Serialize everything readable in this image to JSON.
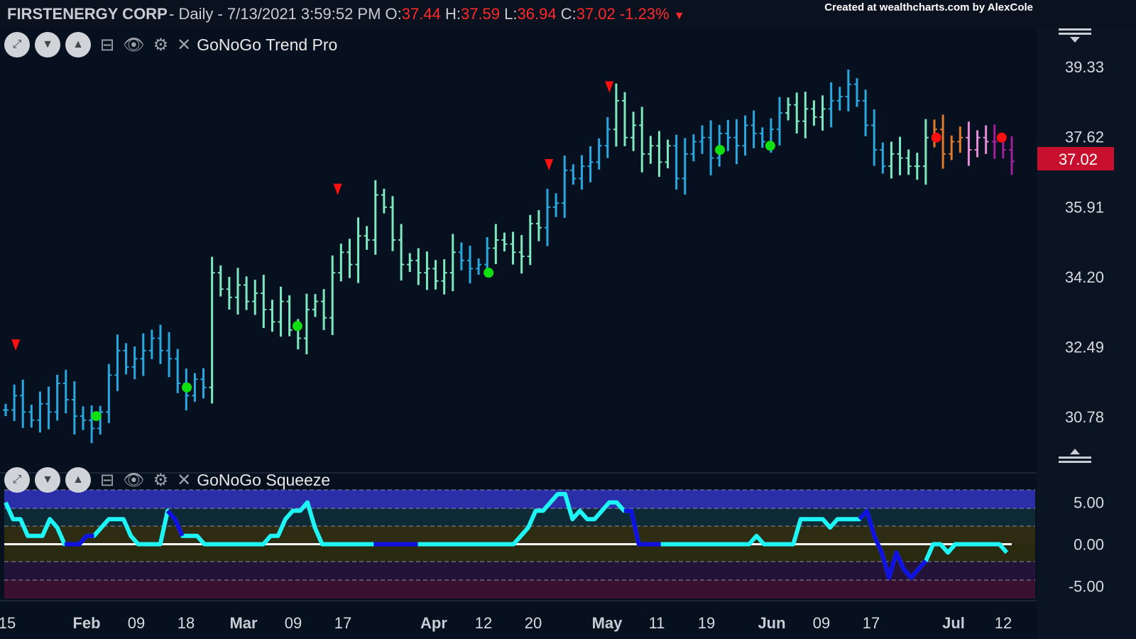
{
  "header": {
    "title": "FIRSTENERGY CORP",
    "interval": "Daily",
    "datetime": "7/13/2021 3:59:52 PM",
    "o_label": "O:",
    "o": "37.44",
    "h_label": "H:",
    "h": "37.59",
    "l_label": "L:",
    "l": "36.94",
    "c_label": "C:",
    "c": "37.02",
    "change": "-1.23%",
    "change_icon": "down-triangle-icon",
    "credit": "Created at wealthcharts.com by AlexCole"
  },
  "panels": {
    "trend": {
      "title": "GoNoGo Trend Pro"
    },
    "squeeze": {
      "title": "GoNoGo Squeeze"
    }
  },
  "colors": {
    "background": "#07101e",
    "go_strong": "#29a8e0",
    "go_weak": "#7ee8c0",
    "nogo_weak": "#e58bd8",
    "nogo_strong": "#a0209a",
    "neutral": "#e07a2c",
    "price_badge": "#c8102e",
    "squeeze_line": "#1ef4f4",
    "squeeze_high": "#1010e0"
  },
  "chart_data": [
    {
      "type": "ohlc",
      "title": "GoNoGo Trend Pro",
      "x_ticks": [
        "15",
        "Feb",
        "09",
        "18",
        "Mar",
        "09",
        "17",
        "Apr",
        "12",
        "20",
        "May",
        "11",
        "19",
        "Jun",
        "09",
        "17",
        "Jul",
        "12"
      ],
      "y_ticks": [
        "39.33",
        "37.62",
        "35.91",
        "34.20",
        "32.49",
        "30.78"
      ],
      "ylim": [
        29.9,
        40.3
      ],
      "last_price": "37.02",
      "close": [
        30.95,
        31.3,
        30.9,
        30.7,
        31.1,
        30.9,
        31.6,
        31.2,
        30.8,
        30.7,
        30.5,
        30.9,
        31.8,
        32.4,
        32.0,
        32.2,
        32.4,
        32.7,
        32.4,
        32.2,
        31.6,
        31.3,
        31.7,
        31.5,
        34.3,
        33.9,
        33.7,
        34.0,
        33.6,
        33.8,
        33.4,
        33.1,
        33.6,
        32.9,
        32.7,
        33.4,
        33.6,
        33.2,
        34.3,
        34.8,
        34.5,
        35.2,
        35.1,
        36.2,
        35.9,
        35.1,
        34.5,
        34.6,
        34.3,
        34.4,
        34.1,
        34.3,
        34.8,
        34.6,
        34.4,
        34.5,
        34.9,
        35.1,
        35.0,
        34.8,
        34.7,
        35.5,
        35.4,
        35.9,
        36.0,
        36.8,
        36.6,
        36.9,
        37.0,
        37.4,
        37.8,
        38.5,
        37.6,
        37.9,
        37.2,
        37.4,
        37.0,
        37.4,
        36.6,
        37.2,
        37.5,
        37.6,
        37.1,
        37.7,
        37.6,
        37.4,
        37.9,
        37.7,
        37.5,
        37.8,
        38.2,
        38.4,
        38.0,
        38.3,
        38.1,
        38.3,
        38.5,
        38.6,
        38.9,
        38.5,
        37.9,
        37.3,
        36.9,
        37.2,
        37.1,
        36.9,
        36.9,
        37.6,
        37.8,
        37.2,
        37.5,
        37.6,
        37.3,
        37.6,
        37.5,
        37.5,
        37.3,
        37.02
      ],
      "zones": [
        {
          "from": 0,
          "to": 0.2,
          "state": "go_strong"
        },
        {
          "from": 0.2,
          "to": 0.45,
          "state": "go_weak"
        },
        {
          "from": 0.45,
          "to": 0.48,
          "state": "go_strong"
        },
        {
          "from": 0.48,
          "to": 0.53,
          "state": "go_weak"
        },
        {
          "from": 0.53,
          "to": 0.6,
          "state": "go_strong"
        },
        {
          "from": 0.6,
          "to": 0.66,
          "state": "go_weak"
        },
        {
          "from": 0.66,
          "to": 0.77,
          "state": "go_strong"
        },
        {
          "from": 0.77,
          "to": 0.82,
          "state": "go_weak"
        },
        {
          "from": 0.82,
          "to": 0.88,
          "state": "go_strong"
        },
        {
          "from": 0.88,
          "to": 0.92,
          "state": "go_weak"
        },
        {
          "from": 0.92,
          "to": 0.95,
          "state": "neutral"
        },
        {
          "from": 0.95,
          "to": 0.98,
          "state": "nogo_weak"
        },
        {
          "from": 0.98,
          "to": 1.0,
          "state": "nogo_strong"
        }
      ],
      "down_arrows": [
        {
          "x": 0.01,
          "y": 32.5
        },
        {
          "x": 0.33,
          "y": 36.3
        },
        {
          "x": 0.54,
          "y": 36.9
        },
        {
          "x": 0.6,
          "y": 38.8
        }
      ],
      "go_dots": [
        {
          "x": 0.09,
          "y": 30.8
        },
        {
          "x": 0.18,
          "y": 31.5
        },
        {
          "x": 0.29,
          "y": 33.0
        },
        {
          "x": 0.48,
          "y": 34.3
        },
        {
          "x": 0.71,
          "y": 37.3
        },
        {
          "x": 0.76,
          "y": 37.4
        }
      ],
      "nogo_dots": [
        {
          "x": 0.925,
          "y": 37.6
        },
        {
          "x": 0.99,
          "y": 37.6
        }
      ]
    },
    {
      "type": "line",
      "title": "GoNoGo Squeeze",
      "y_ticks": [
        "5.00",
        "0.00",
        "-5.00"
      ],
      "ylim": [
        -6.5,
        6.5
      ],
      "zero_line": 0,
      "values": [
        5,
        3,
        3,
        1,
        1,
        1,
        3,
        2,
        0,
        0,
        0,
        1,
        1,
        2,
        3,
        3,
        3,
        1,
        0,
        0,
        0,
        0,
        4,
        3,
        1,
        1,
        1,
        0,
        0,
        0,
        0,
        0,
        0,
        0,
        0,
        0,
        1,
        1,
        3,
        4,
        4,
        5,
        2,
        0,
        0,
        0,
        0,
        0,
        0,
        0,
        0,
        0,
        0,
        0,
        0,
        0,
        0,
        0,
        0,
        0,
        0,
        0,
        0,
        0,
        0,
        0,
        0,
        0,
        0,
        0,
        1,
        2,
        4,
        4,
        5,
        6,
        6,
        3,
        4,
        3,
        3,
        4,
        5,
        5,
        4,
        4,
        0,
        0,
        0,
        0,
        0,
        0,
        0,
        0,
        0,
        0,
        0,
        0,
        0,
        0,
        0,
        0,
        1,
        0,
        0,
        0,
        0,
        0,
        3,
        3,
        3,
        3,
        2,
        3,
        3,
        3,
        3,
        4,
        1,
        -1,
        -4,
        -1,
        -3,
        -4,
        -3,
        -2,
        0,
        0,
        -1,
        0,
        0,
        0,
        0,
        0,
        0,
        0,
        -1
      ],
      "high_segments": [
        [
          8,
          12
        ],
        [
          22,
          24
        ],
        [
          50,
          56
        ],
        [
          84,
          89
        ],
        [
          116,
          125
        ]
      ]
    }
  ]
}
